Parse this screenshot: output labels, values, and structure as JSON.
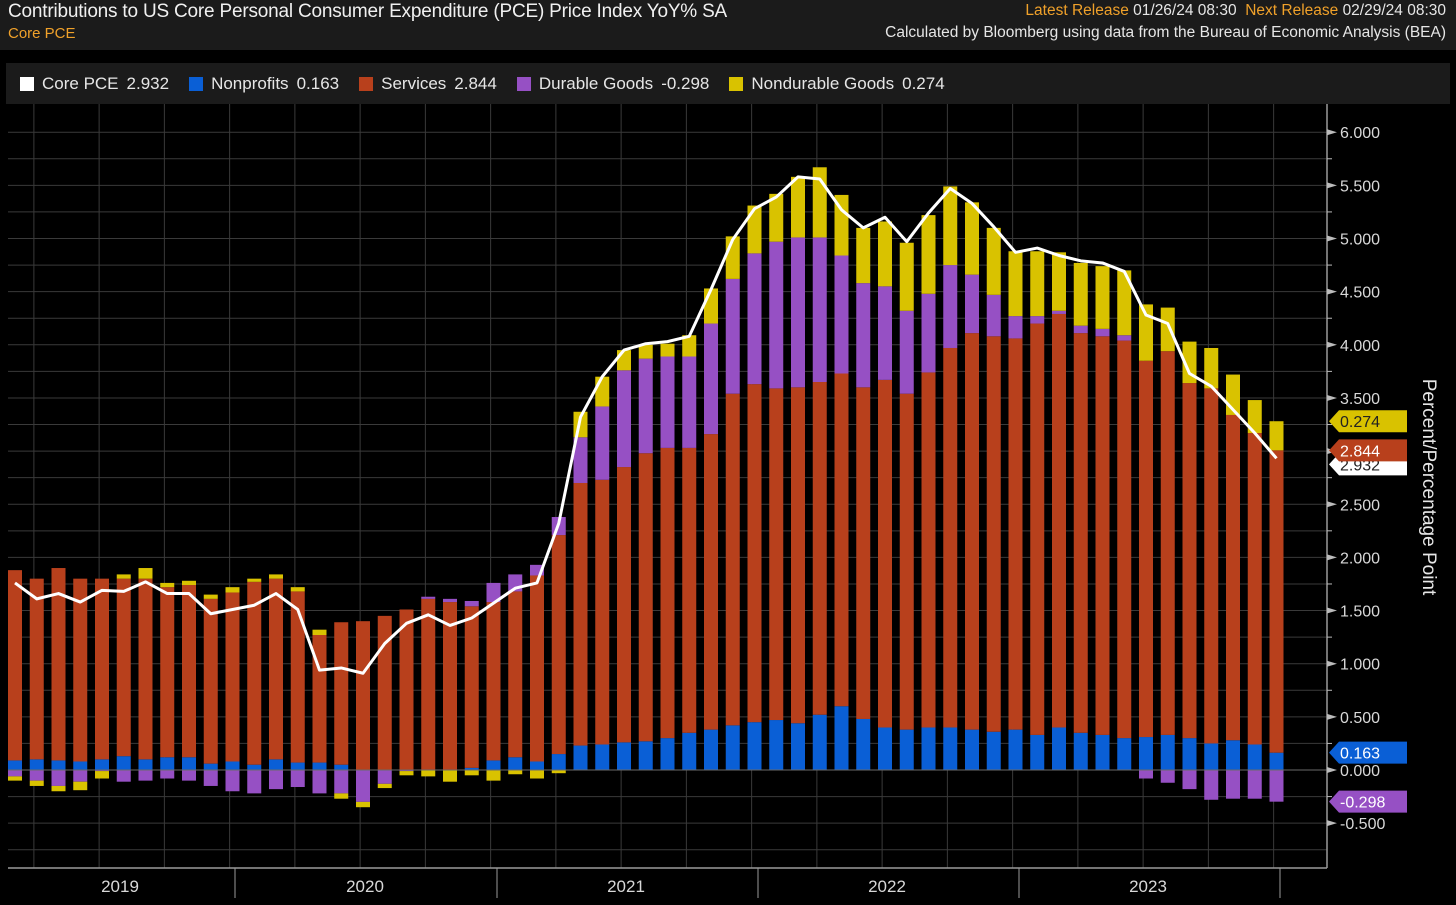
{
  "header": {
    "title": "Contributions to US Core Personal Consumer Expenditure (PCE) Price Index YoY% SA",
    "subtitle": "Core PCE",
    "latest_label": "Latest Release",
    "latest_value": "01/26/24 08:30",
    "next_label": "Next Release",
    "next_value": "02/29/24 08:30",
    "source": "Calculated by Bloomberg using data from the Bureau of Economic Analysis (BEA)"
  },
  "legend": [
    {
      "name": "Core PCE",
      "value": "2.932",
      "color": "#ffffff"
    },
    {
      "name": "Nonprofits",
      "value": "0.163",
      "color": "#0a5fd6"
    },
    {
      "name": "Services",
      "value": "2.844",
      "color": "#b8401c"
    },
    {
      "name": "Durable Goods",
      "value": "-0.298",
      "color": "#9650c4"
    },
    {
      "name": "Nondurable Goods",
      "value": "0.274",
      "color": "#d9c200"
    }
  ],
  "chart_data": {
    "type": "bar",
    "stacked": true,
    "title": "Contributions to US Core Personal Consumer Expenditure (PCE) Price Index YoY% SA",
    "ylabel": "Percent/Percentage Point",
    "ylim": [
      -0.75,
      6.2
    ],
    "yticks": [
      "-0.500",
      "0.000",
      "0.500",
      "1.000",
      "1.500",
      "2.000",
      "2.500",
      "3.000",
      "3.500",
      "4.000",
      "4.500",
      "5.000",
      "5.500",
      "6.000"
    ],
    "ytick_values": [
      -0.5,
      0,
      0.5,
      1,
      1.5,
      2,
      2.5,
      3,
      3.5,
      4,
      4.5,
      5,
      5.5,
      6
    ],
    "x_start": "2019-02",
    "x_end": "2023-12",
    "frequency": "monthly",
    "year_labels": [
      "2019",
      "2020",
      "2021",
      "2022",
      "2023"
    ],
    "grid": true,
    "series": [
      {
        "name": "Nonprofits",
        "color": "#0a5fd6",
        "values": [
          0.09,
          0.1,
          0.09,
          0.08,
          0.1,
          0.13,
          0.1,
          0.12,
          0.12,
          0.06,
          0.08,
          0.05,
          0.1,
          0.07,
          0.07,
          0.05,
          0.0,
          0.0,
          0.0,
          0.0,
          0.0,
          0.02,
          0.09,
          0.12,
          0.08,
          0.15,
          0.23,
          0.24,
          0.26,
          0.27,
          0.3,
          0.35,
          0.38,
          0.42,
          0.45,
          0.47,
          0.44,
          0.52,
          0.6,
          0.48,
          0.4,
          0.38,
          0.4,
          0.4,
          0.38,
          0.36,
          0.38,
          0.33,
          0.4,
          0.35,
          0.33,
          0.3,
          0.31,
          0.33,
          0.3,
          0.25,
          0.28,
          0.24,
          0.163
        ]
      },
      {
        "name": "Services",
        "color": "#b8401c",
        "values": [
          1.79,
          1.7,
          1.81,
          1.72,
          1.7,
          1.67,
          1.7,
          1.6,
          1.62,
          1.55,
          1.59,
          1.72,
          1.7,
          1.61,
          1.2,
          1.34,
          1.4,
          1.45,
          1.51,
          1.61,
          1.58,
          1.52,
          1.49,
          1.56,
          1.75,
          2.06,
          2.47,
          2.49,
          2.59,
          2.71,
          2.73,
          2.68,
          2.78,
          3.12,
          3.18,
          3.12,
          3.16,
          3.13,
          3.13,
          3.12,
          3.27,
          3.16,
          3.34,
          3.57,
          3.73,
          3.72,
          3.68,
          3.87,
          3.89,
          3.76,
          3.75,
          3.74,
          3.54,
          3.61,
          3.34,
          3.34,
          3.06,
          2.93,
          2.844
        ]
      },
      {
        "name": "Durable Goods",
        "color": "#9650c4",
        "values": [
          -0.06,
          -0.1,
          -0.15,
          -0.11,
          -0.01,
          -0.11,
          -0.1,
          -0.08,
          -0.1,
          -0.15,
          -0.2,
          -0.22,
          -0.18,
          -0.16,
          -0.22,
          -0.22,
          -0.3,
          -0.13,
          -0.01,
          0.02,
          0.03,
          0.05,
          0.18,
          0.16,
          0.1,
          0.17,
          0.43,
          0.69,
          0.91,
          0.89,
          0.86,
          0.86,
          1.04,
          1.08,
          1.23,
          1.38,
          1.41,
          1.36,
          1.11,
          0.98,
          0.88,
          0.78,
          0.74,
          0.78,
          0.55,
          0.39,
          0.21,
          0.07,
          0.03,
          0.07,
          0.07,
          0.05,
          -0.08,
          -0.12,
          -0.18,
          -0.28,
          -0.27,
          -0.27,
          -0.298
        ]
      },
      {
        "name": "Nondurable Goods",
        "color": "#d9c200",
        "values": [
          -0.04,
          -0.05,
          -0.05,
          -0.08,
          -0.07,
          0.04,
          0.1,
          0.04,
          0.04,
          0.04,
          0.05,
          0.03,
          0.04,
          0.04,
          0.05,
          -0.05,
          -0.05,
          -0.04,
          -0.04,
          -0.06,
          -0.11,
          -0.05,
          -0.1,
          -0.04,
          -0.08,
          -0.03,
          0.24,
          0.28,
          0.19,
          0.13,
          0.12,
          0.2,
          0.33,
          0.4,
          0.45,
          0.45,
          0.57,
          0.66,
          0.57,
          0.52,
          0.61,
          0.64,
          0.74,
          0.74,
          0.68,
          0.63,
          0.61,
          0.61,
          0.55,
          0.59,
          0.59,
          0.61,
          0.53,
          0.41,
          0.39,
          0.38,
          0.38,
          0.31,
          0.274
        ]
      }
    ],
    "line": {
      "name": "Core PCE",
      "color": "#ffffff",
      "values": [
        1.76,
        1.61,
        1.66,
        1.58,
        1.69,
        1.68,
        1.77,
        1.66,
        1.66,
        1.47,
        1.51,
        1.55,
        1.66,
        1.51,
        0.94,
        0.96,
        0.91,
        1.19,
        1.38,
        1.46,
        1.36,
        1.43,
        1.57,
        1.71,
        1.76,
        2.32,
        3.32,
        3.7,
        3.95,
        4.01,
        4.03,
        4.08,
        4.52,
        4.99,
        5.28,
        5.39,
        5.58,
        5.56,
        5.27,
        5.1,
        5.2,
        4.97,
        5.24,
        5.47,
        5.33,
        5.11,
        4.87,
        4.91,
        4.84,
        4.79,
        4.77,
        4.69,
        4.28,
        4.2,
        3.73,
        3.61,
        3.39,
        3.17,
        2.932
      ]
    },
    "last_value_tags": [
      {
        "series": "Nondurable Goods",
        "label": "0.274",
        "color": "#d9c200",
        "text_color": "#222222"
      },
      {
        "series": "Services",
        "label": "2.844",
        "color": "#b8401c",
        "text_color": "#ffffff"
      },
      {
        "series": "Core PCE",
        "label": "2.932",
        "color": "#ffffff",
        "text_color": "#222222"
      },
      {
        "series": "Nonprofits",
        "label": "0.163",
        "color": "#0a5fd6",
        "text_color": "#ffffff"
      },
      {
        "series": "Durable Goods",
        "label": "-0.298",
        "color": "#9650c4",
        "text_color": "#ffffff"
      }
    ]
  }
}
